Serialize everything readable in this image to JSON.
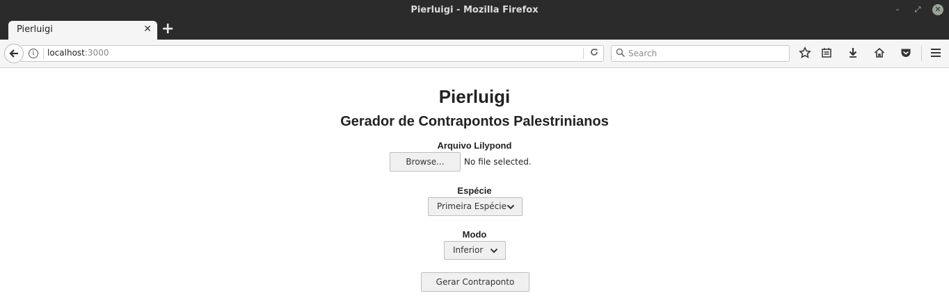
{
  "window": {
    "title": "Pierluigi - Mozilla Firefox",
    "controls": {
      "minimize": "–",
      "maximize": "⤢",
      "close": "✕"
    }
  },
  "tabs": [
    {
      "label": "Pierluigi",
      "close": "✕"
    }
  ],
  "new_tab": "+",
  "navbar": {
    "url_host": "localhost",
    "url_port": ":3000",
    "search_placeholder": "Search"
  },
  "icons": {
    "back": "back-arrow-icon",
    "info": "info-icon",
    "reload": "reload-icon",
    "search": "search-icon",
    "bookmark": "star-icon",
    "reader": "reading-list-icon",
    "downloads": "download-icon",
    "home": "home-icon",
    "pocket": "pocket-icon",
    "menu": "hamburger-menu-icon"
  },
  "page": {
    "title": "Pierluigi",
    "subtitle": "Gerador de Contrapontos Palestrinianos",
    "file_label": "Arquivo Lilypond",
    "browse_button": "Browse...",
    "file_status": "No file selected.",
    "species_label": "Espécie",
    "species_value": "Primeira Espécie",
    "mode_label": "Modo",
    "mode_value": "Inferior",
    "submit_button": "Gerar Contraponto"
  }
}
